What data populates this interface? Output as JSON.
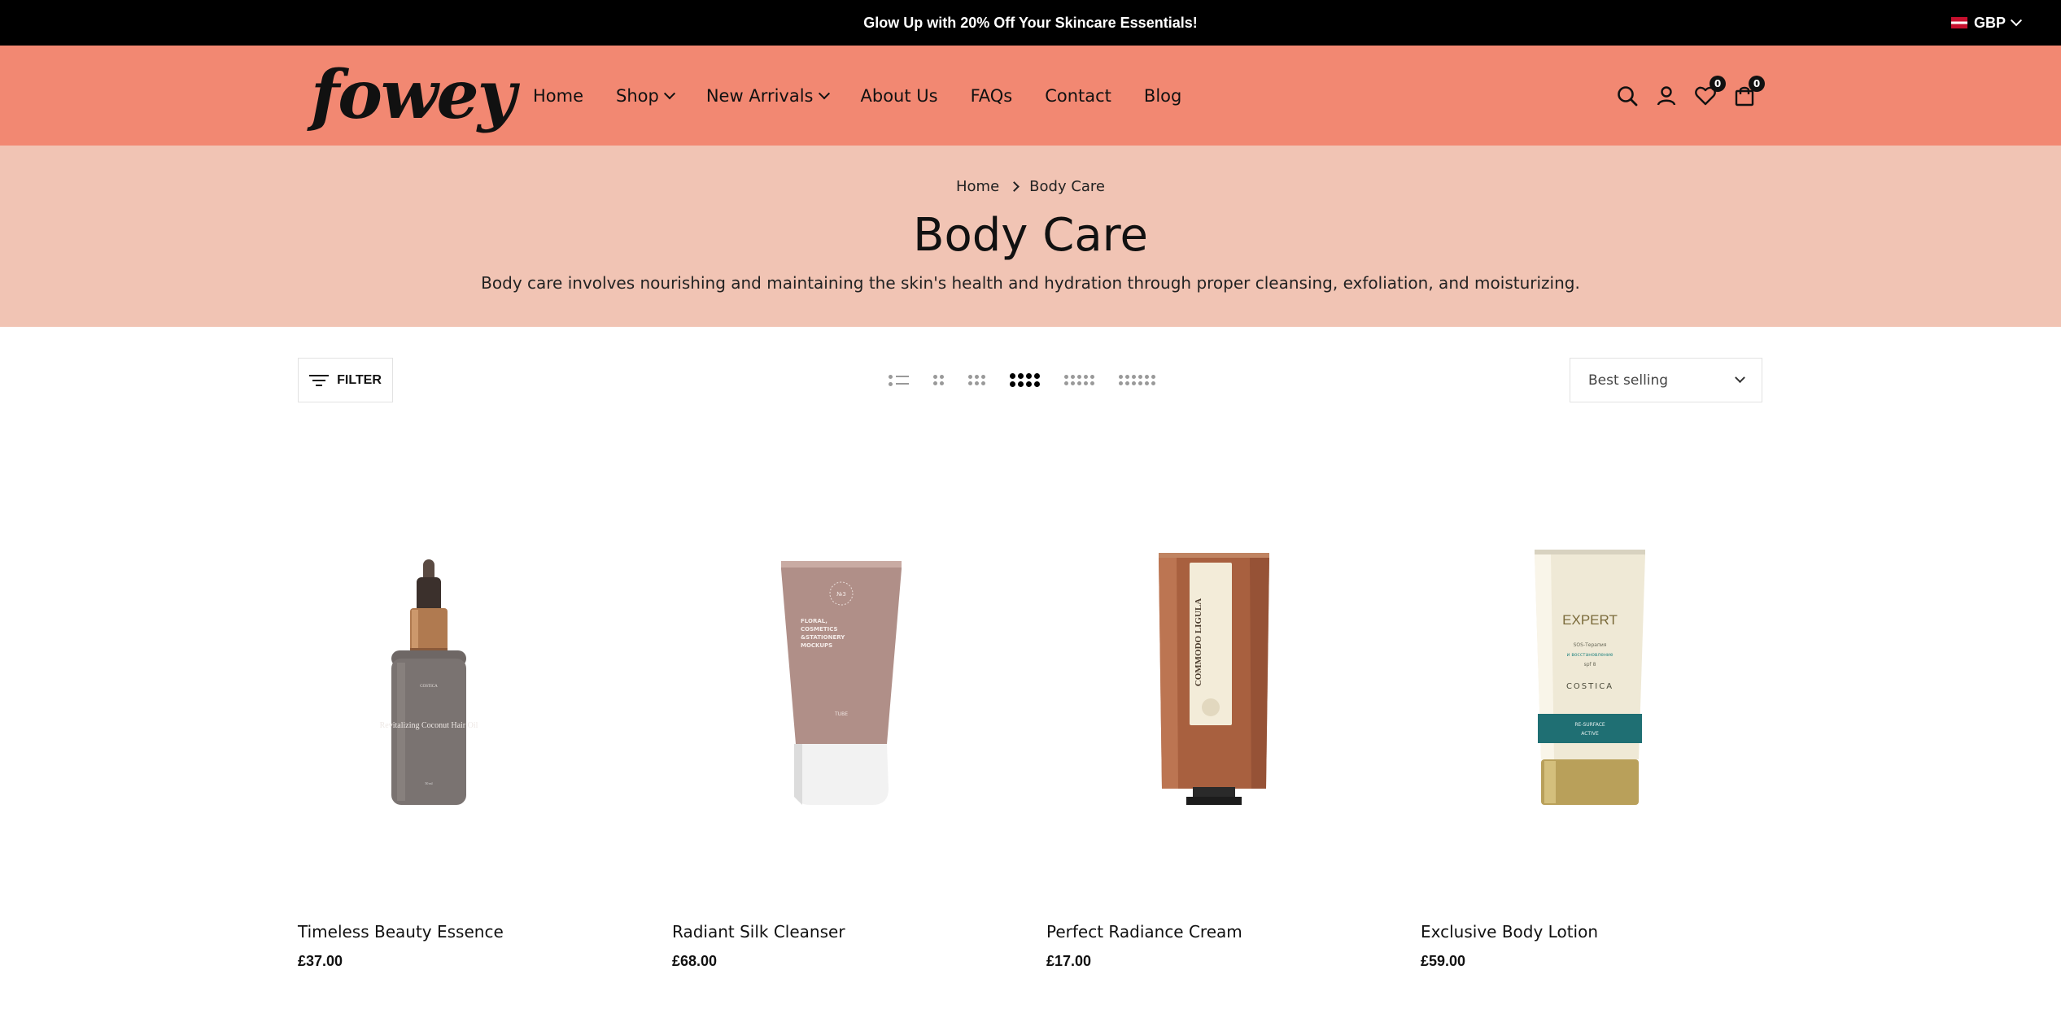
{
  "announcement": {
    "text": "Glow Up with 20% Off Your Skincare Essentials!"
  },
  "currency": {
    "code": "GBP"
  },
  "header": {
    "logo": "fowey",
    "nav": [
      {
        "label": "Home",
        "has_dropdown": false
      },
      {
        "label": "Shop",
        "has_dropdown": true
      },
      {
        "label": "New Arrivals",
        "has_dropdown": true
      },
      {
        "label": "About Us",
        "has_dropdown": false
      },
      {
        "label": "FAQs",
        "has_dropdown": false
      },
      {
        "label": "Contact",
        "has_dropdown": false
      },
      {
        "label": "Blog",
        "has_dropdown": false
      }
    ],
    "icons": [
      "search-icon",
      "account-icon",
      "wishlist-icon",
      "cart-icon"
    ],
    "wishlist_count": "0",
    "cart_count": "0"
  },
  "hero": {
    "breadcrumb": [
      "Home",
      "Body Care"
    ],
    "title": "Body Care",
    "description": "Body care involves nourishing and maintaining the skin's health and hydration through proper cleansing, exfoliation, and moisturizing."
  },
  "toolbar": {
    "filter_label": "FILTER",
    "grid_options": [
      "list",
      "2",
      "3",
      "4",
      "5",
      "6"
    ],
    "active_grid": "4",
    "sort_value": "Best selling"
  },
  "products": [
    {
      "title": "Timeless Beauty Essence",
      "price": "£37.00",
      "label_text": "Revitalizing Coconut Hair Oil"
    },
    {
      "title": "Radiant Silk Cleanser",
      "price": "£68.00",
      "label_text": "FLORAL, COSMETICS &STATIONERY MOCKUPS"
    },
    {
      "title": "Perfect Radiance Cream",
      "price": "£17.00",
      "label_text": "COMMODO LIGULA"
    },
    {
      "title": "Exclusive Body Lotion",
      "price": "£59.00",
      "label_text": "EXPERT"
    }
  ],
  "colors": {
    "announcement_bg": "#000000",
    "header_bg": "#f28872",
    "hero_bg": "#f1c4b4",
    "text": "#111111"
  }
}
